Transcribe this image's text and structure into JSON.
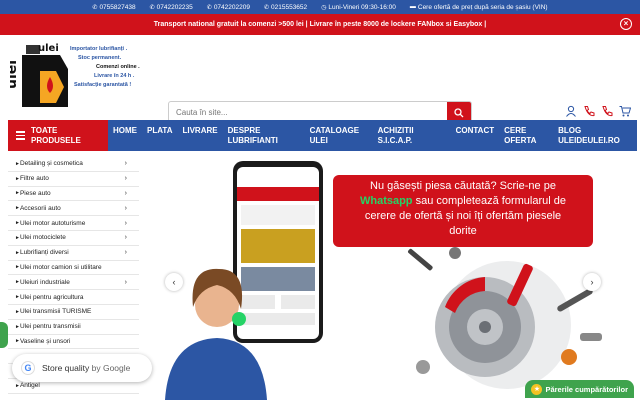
{
  "topbar": {
    "phones": [
      "0755827438",
      "0742202235",
      "0742202209",
      "0215553652"
    ],
    "hours": "Luni-Vineri 09:30-16:00",
    "vin_offer": "Cere ofertă de preț după seria de șasiu (VIN)"
  },
  "promo": {
    "text": "Transport national gratuit la comenzi >500 lei | Livrare în peste 8000 de lockere FANbox si Easybox |"
  },
  "logo": {
    "brand": "ulei de ulei",
    "taglines": [
      "Importator lubrifianți .",
      "Stoc permanent.",
      "Comenzi online .",
      "Livrare în 24 h .",
      "Satisfacție garantată !"
    ]
  },
  "search": {
    "placeholder": "Cauta în site..."
  },
  "nav": {
    "all_products": "TOATE PRODUSELE",
    "items": [
      "HOME",
      "PLATA",
      "LIVRARE",
      "DESPRE LUBRIFIANTI",
      "CATALOAGE ULEI",
      "ACHIZITII S.I.C.A.P.",
      "CONTACT",
      "CERE OFERTA",
      "BLOG ULEIDEULEI.RO"
    ]
  },
  "sidebar": {
    "items": [
      {
        "label": "Detailing și cosmetica",
        "arrow": true
      },
      {
        "label": "Filtre auto",
        "arrow": true
      },
      {
        "label": "Piese auto",
        "arrow": true
      },
      {
        "label": "Accesorii auto",
        "arrow": true
      },
      {
        "label": "Ulei motor autoturisme",
        "arrow": true
      },
      {
        "label": "Ulei motociclete",
        "arrow": true
      },
      {
        "label": "Lubrifianți diversi",
        "arrow": true
      },
      {
        "label": "Ulei motor camion si utilitare",
        "arrow": false
      },
      {
        "label": "Uleiuri industriale",
        "arrow": true
      },
      {
        "label": "Ulei pentru agricultura",
        "arrow": false
      },
      {
        "label": "Ulei transmisii TURISME",
        "arrow": false
      },
      {
        "label": "Ulei pentru transmisii",
        "arrow": false
      },
      {
        "label": "Vaseline și unsori",
        "arrow": false
      },
      {
        "label": "",
        "arrow": false
      },
      {
        "label": "",
        "arrow": false
      },
      {
        "label": "Antigel",
        "arrow": false
      }
    ]
  },
  "hero": {
    "headline_1": "Nu găsești piesa căutată? Scrie-ne pe",
    "headline_whatsapp": "Whatsapp",
    "headline_2": "sau completează formularul de",
    "headline_3": "cerere de ofertă și noi îți ofertăm piesele",
    "headline_4": "dorite"
  },
  "store_quality": {
    "label": "Store quality",
    "by": "by Google"
  },
  "reviews": {
    "label": "Părerile cumpărătorilor"
  },
  "colors": {
    "blue": "#2c56a4",
    "red": "#d0121b",
    "green": "#3fa34d",
    "whatsapp": "#25d366"
  }
}
